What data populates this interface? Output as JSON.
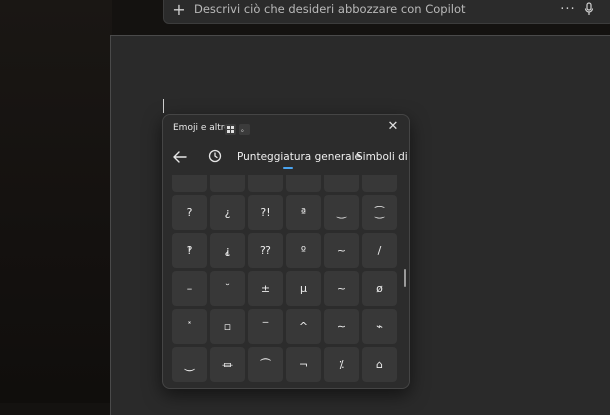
{
  "copilot_bar": {
    "plus_icon": "+",
    "placeholder": "Descrivi ciò che desideri abbozzare con Copilot",
    "more_icon": "···"
  },
  "panel": {
    "title": "Emoji e altro",
    "shortcut_dot": "。",
    "close": "✕",
    "tabs": {
      "active": "Punteggiatura generale",
      "next": "Simboli di va"
    },
    "accent_color": "#4aa4f0",
    "rows": [
      [
        "",
        "",
        "",
        "",
        "",
        ""
      ],
      [
        "?",
        "¿",
        "?!",
        "ª",
        "‿",
        "⁐"
      ],
      [
        "‽",
        "⸘",
        "⁇",
        "º",
        "~",
        "/"
      ],
      [
        "–",
        "˘",
        "±",
        "μ",
        "~",
        "ø"
      ],
      [
        "˟",
        "▫",
        "‾",
        "^",
        "∼",
        "⌁"
      ],
      [
        "⏝",
        "⏛",
        "⏜",
        "¬",
        "⁒",
        "⌂"
      ]
    ]
  }
}
